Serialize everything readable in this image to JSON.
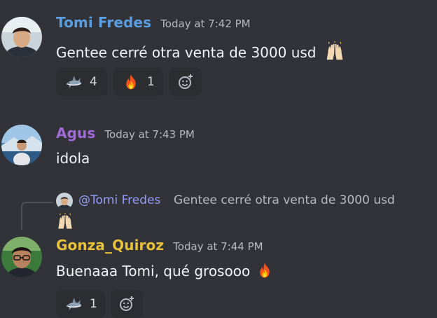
{
  "colors": {
    "background": "#313338",
    "tomi_name": "#5b9ee0",
    "agus_name": "#a06ad8",
    "gonza_name": "#e8c13a",
    "mention": "#949cf7",
    "reaction_bg": "#2b2d31"
  },
  "messages": [
    {
      "author": "Tomi Fredes",
      "timestamp": "Today at 7:42 PM",
      "text": "Gentee cerré otra venta de 3000 usd",
      "text_emoji": "raised-hands-emoji",
      "reactions": [
        {
          "emoji": "shark-emoji",
          "count": "4"
        },
        {
          "emoji": "fire-emoji",
          "count": "1"
        }
      ]
    },
    {
      "author": "Agus",
      "timestamp": "Today at 7:43 PM",
      "text": "idola"
    },
    {
      "reply_to": {
        "mention": "@Tomi Fredes",
        "text": "Gentee cerré otra venta de 3000 usd",
        "emoji": "raised-hands-emoji"
      },
      "author": "Gonza_Quiroz",
      "timestamp": "Today at 7:44 PM",
      "text": "Buenaaa Tomi, qué grosooo",
      "text_emoji": "fire-emoji",
      "reactions": [
        {
          "emoji": "shark-emoji",
          "count": "1"
        }
      ]
    }
  ]
}
